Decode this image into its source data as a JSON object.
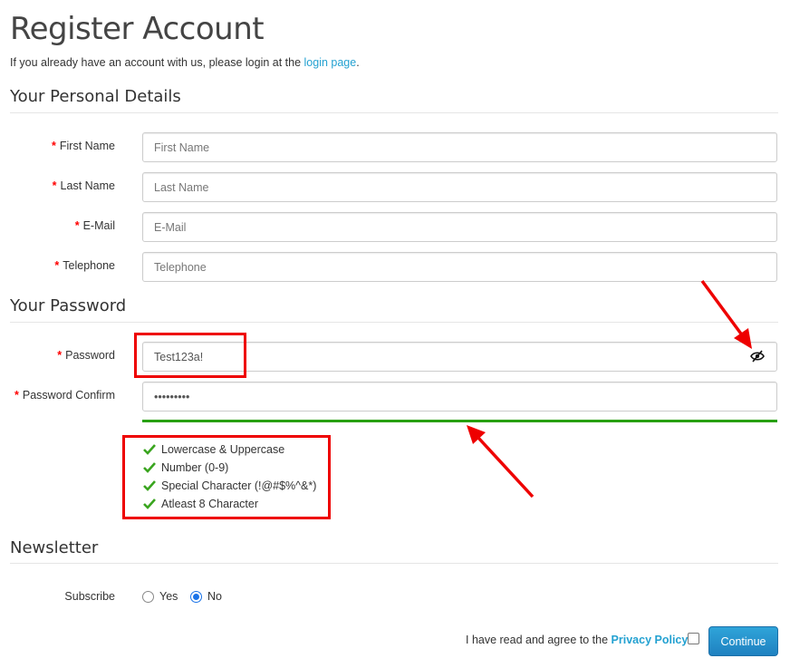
{
  "page": {
    "title": "Register Account",
    "intro_text": "If you already have an account with us, please login at the ",
    "intro_link": "login page",
    "intro_end": "."
  },
  "personal": {
    "legend": "Your Personal Details",
    "required_mark": "*",
    "first_name": {
      "label": "First Name",
      "placeholder": "First Name",
      "value": ""
    },
    "last_name": {
      "label": "Last Name",
      "placeholder": "Last Name",
      "value": ""
    },
    "email": {
      "label": "E-Mail",
      "placeholder": "E-Mail",
      "value": ""
    },
    "telephone": {
      "label": "Telephone",
      "placeholder": "Telephone",
      "value": ""
    }
  },
  "password_section": {
    "legend": "Your Password",
    "password": {
      "label": "Password",
      "value": "Test123a!",
      "toggle_icon": "eye-slash-icon"
    },
    "confirm": {
      "label": "Password Confirm",
      "value": "•••••••••"
    },
    "strength_color": "#28a010",
    "rules": [
      {
        "text": "Lowercase & Uppercase",
        "icon": "check-icon"
      },
      {
        "text": "Number (0-9)",
        "icon": "check-icon"
      },
      {
        "text": "Special Character (!@#$%^&*)",
        "icon": "check-icon"
      },
      {
        "text": "Atleast 8 Character",
        "icon": "check-icon"
      }
    ]
  },
  "newsletter": {
    "legend": "Newsletter",
    "subscribe_label": "Subscribe",
    "options": [
      {
        "label": "Yes",
        "selected": false
      },
      {
        "label": "No",
        "selected": true
      }
    ]
  },
  "footer": {
    "agree_text": "I have read and agree to the ",
    "privacy_link": "Privacy Policy",
    "agree_checked": false,
    "continue_label": "Continue"
  },
  "annotation_color": "#ee0000"
}
